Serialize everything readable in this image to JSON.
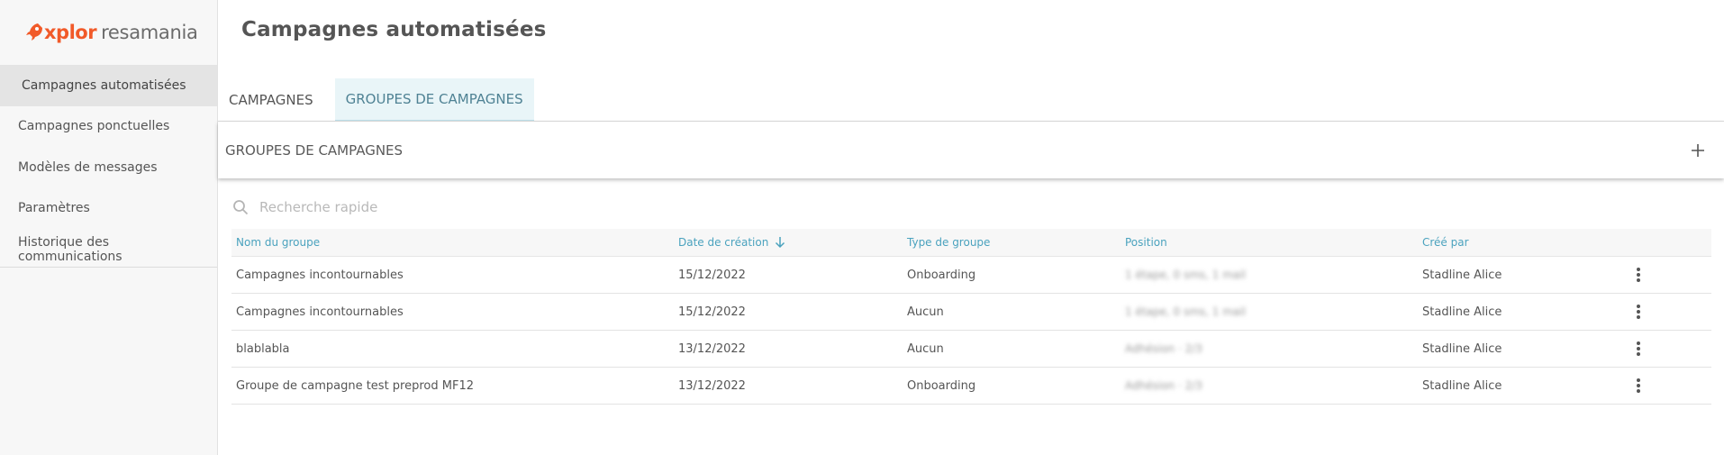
{
  "brand": {
    "logo_primary": "xplor",
    "logo_secondary": "resamania",
    "accent_color": "#f15a29"
  },
  "sidebar": {
    "items": [
      {
        "label": "Campagnes automatisées",
        "active": true
      },
      {
        "label": "Campagnes ponctuelles",
        "active": false
      },
      {
        "label": "Modèles de messages",
        "active": false
      },
      {
        "label": "Paramètres",
        "active": false
      },
      {
        "label": "Historique des communications",
        "active": false
      }
    ]
  },
  "header": {
    "title": "Campagnes automatisées"
  },
  "tabs": [
    {
      "label": "CAMPAGNES",
      "active": false
    },
    {
      "label": "GROUPES DE CAMPAGNES",
      "active": true
    }
  ],
  "section": {
    "title": "GROUPES DE CAMPAGNES",
    "add_icon": "plus-icon"
  },
  "search": {
    "placeholder": "Recherche rapide",
    "value": ""
  },
  "table": {
    "columns": {
      "name": "Nom du groupe",
      "date": "Date de création",
      "type": "Type de groupe",
      "position": "Position",
      "creator": "Créé par"
    },
    "sort_icon": "arrow-down-icon",
    "rows": [
      {
        "name": "Campagnes incontournables",
        "date": "15/12/2022",
        "type": "Onboarding",
        "position": "1 étape, 0 sms, 1 mail",
        "creator": "Stadline Alice"
      },
      {
        "name": "Campagnes incontournables",
        "date": "15/12/2022",
        "type": "Aucun",
        "position": "1 étape, 0 sms, 1 mail",
        "creator": "Stadline Alice"
      },
      {
        "name": "blablabla",
        "date": "13/12/2022",
        "type": "Aucun",
        "position": "Adhésion · 2/3",
        "creator": "Stadline Alice"
      },
      {
        "name": "Groupe de campagne test preprod MF12",
        "date": "13/12/2022",
        "type": "Onboarding",
        "position": "Adhésion · 2/3",
        "creator": "Stadline Alice"
      }
    ]
  }
}
